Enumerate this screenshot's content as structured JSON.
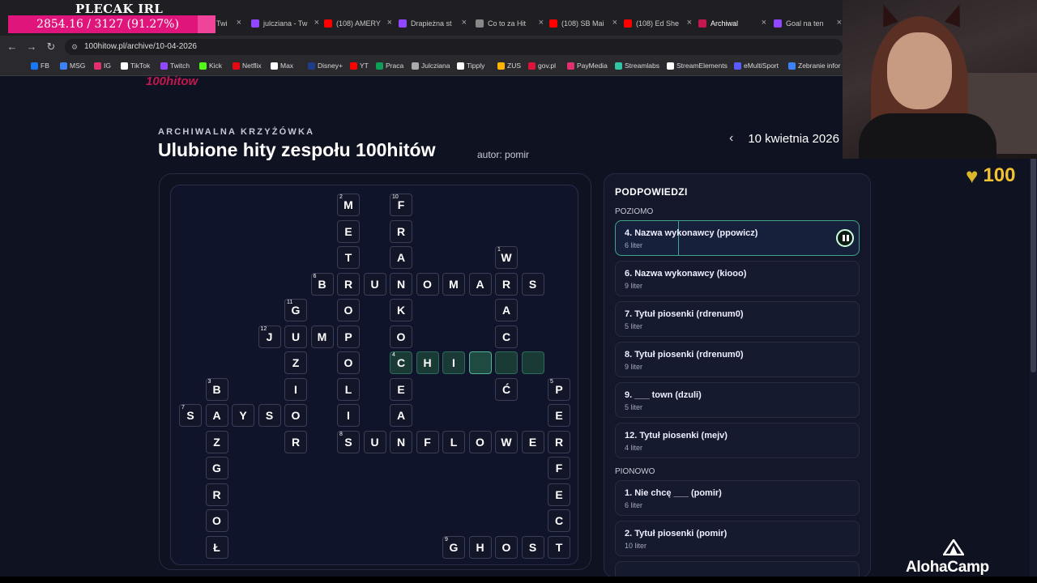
{
  "overlay": {
    "title": "PLECAK IRL",
    "goal_text": "2854.16 / 3127 (91.27%)",
    "goal_progress": 0.9127
  },
  "browser": {
    "tabs": [
      {
        "label": "Twi",
        "color": "#9146ff"
      },
      {
        "label": "julcziana - Tw",
        "color": "#9146ff"
      },
      {
        "label": "(108) AMERY",
        "color": "#ff0000"
      },
      {
        "label": "Drapieżna st",
        "color": "#9146ff"
      },
      {
        "label": "Co to za Hit",
        "color": "#888888"
      },
      {
        "label": "(108) SB Mai",
        "color": "#ff0000"
      },
      {
        "label": "(108) Ed She",
        "color": "#ff0000"
      },
      {
        "label": "Archiwal",
        "color": "#c2184f"
      },
      {
        "label": "Goal na ten",
        "color": "#9146ff"
      }
    ],
    "url": "100hitow.pl/archive/10-04-2026",
    "bookmarks": [
      {
        "label": "FB",
        "color": "#1877f2"
      },
      {
        "label": "MSG",
        "color": "#3b82f6"
      },
      {
        "label": "IG",
        "color": "#e1306c"
      },
      {
        "label": "TikTok",
        "color": "#ffffff"
      },
      {
        "label": "Twitch",
        "color": "#9146ff"
      },
      {
        "label": "Kick",
        "color": "#53fc18"
      },
      {
        "label": "Netflix",
        "color": "#e50914"
      },
      {
        "label": "Max",
        "color": "#ffffff"
      },
      {
        "label": "Disney+",
        "color": "#1f3c88"
      },
      {
        "label": "YT",
        "color": "#ff0000"
      },
      {
        "label": "Praca",
        "color": "#0f9d58"
      },
      {
        "label": "Julcziana",
        "color": "#aaaaaa"
      },
      {
        "label": "Tipply",
        "color": "#ffffff"
      },
      {
        "label": "ZUS",
        "color": "#ffb400"
      },
      {
        "label": "gov.pl",
        "color": "#dc143c"
      },
      {
        "label": "PayMedia",
        "color": "#e1306c"
      },
      {
        "label": "Streamlabs",
        "color": "#31c3a2"
      },
      {
        "label": "StreamElements",
        "color": "#ffffff"
      },
      {
        "label": "eMultiSport",
        "color": "#5a5aff"
      },
      {
        "label": "Zebranie infor",
        "color": "#3b82f6"
      }
    ]
  },
  "page": {
    "logo": "100hitow",
    "eyebrow": "ARCHIWALNA KRZYŻÓWKA",
    "title": "Ulubione hity zespołu 100hitów",
    "author": "autor: pomir",
    "date": "10 kwietnia 2026",
    "coins": "100"
  },
  "crossword": {
    "cells": [
      {
        "l": "M",
        "c": 6,
        "r": 0,
        "n": "2"
      },
      {
        "l": "E",
        "c": 6,
        "r": 1
      },
      {
        "l": "T",
        "c": 6,
        "r": 2
      },
      {
        "l": "R",
        "c": 6,
        "r": 3
      },
      {
        "l": "O",
        "c": 6,
        "r": 4
      },
      {
        "l": "P",
        "c": 6,
        "r": 5
      },
      {
        "l": "O",
        "c": 6,
        "r": 6
      },
      {
        "l": "L",
        "c": 6,
        "r": 7
      },
      {
        "l": "I",
        "c": 6,
        "r": 8
      },
      {
        "l": "S",
        "c": 6,
        "r": 9,
        "n": "8"
      },
      {
        "l": "F",
        "c": 8,
        "r": 0,
        "n": "10"
      },
      {
        "l": "R",
        "c": 8,
        "r": 1
      },
      {
        "l": "A",
        "c": 8,
        "r": 2
      },
      {
        "l": "N",
        "c": 8,
        "r": 3
      },
      {
        "l": "K",
        "c": 8,
        "r": 4
      },
      {
        "l": "O",
        "c": 8,
        "r": 5
      },
      {
        "l": "C",
        "c": 8,
        "r": 6,
        "n": "4",
        "s": "active"
      },
      {
        "l": "E",
        "c": 8,
        "r": 7
      },
      {
        "l": "A",
        "c": 8,
        "r": 8
      },
      {
        "l": "N",
        "c": 8,
        "r": 9
      },
      {
        "l": "W",
        "c": 12,
        "r": 2,
        "n": "1"
      },
      {
        "l": "R",
        "c": 12,
        "r": 3
      },
      {
        "l": "A",
        "c": 12,
        "r": 4
      },
      {
        "l": "C",
        "c": 12,
        "r": 5
      },
      {
        "l": "",
        "c": 12,
        "r": 6,
        "s": "active"
      },
      {
        "l": "Ć",
        "c": 12,
        "r": 7
      },
      {
        "l": "W",
        "c": 12,
        "r": 9
      },
      {
        "l": "B",
        "c": 5,
        "r": 3,
        "n": "6"
      },
      {
        "l": "U",
        "c": 7,
        "r": 3
      },
      {
        "l": "O",
        "c": 9,
        "r": 3
      },
      {
        "l": "M",
        "c": 10,
        "r": 3
      },
      {
        "l": "A",
        "c": 11,
        "r": 3
      },
      {
        "l": "S",
        "c": 13,
        "r": 3
      },
      {
        "l": "G",
        "c": 4,
        "r": 4,
        "n": "11"
      },
      {
        "l": "U",
        "c": 4,
        "r": 5
      },
      {
        "l": "Z",
        "c": 4,
        "r": 6
      },
      {
        "l": "I",
        "c": 4,
        "r": 7
      },
      {
        "l": "O",
        "c": 4,
        "r": 8
      },
      {
        "l": "R",
        "c": 4,
        "r": 9
      },
      {
        "l": "J",
        "c": 3,
        "r": 5,
        "n": "12"
      },
      {
        "l": "M",
        "c": 5,
        "r": 5
      },
      {
        "l": "H",
        "c": 9,
        "r": 6,
        "s": "active"
      },
      {
        "l": "I",
        "c": 10,
        "r": 6,
        "s": "active"
      },
      {
        "l": "",
        "c": 11,
        "r": 6,
        "s": "cursor"
      },
      {
        "l": "",
        "c": 13,
        "r": 6,
        "s": "active"
      },
      {
        "l": "B",
        "c": 1,
        "r": 7,
        "n": "3"
      },
      {
        "l": "A",
        "c": 1,
        "r": 8
      },
      {
        "l": "Z",
        "c": 1,
        "r": 9
      },
      {
        "l": "G",
        "c": 1,
        "r": 10
      },
      {
        "l": "R",
        "c": 1,
        "r": 11
      },
      {
        "l": "O",
        "c": 1,
        "r": 12
      },
      {
        "l": "Ł",
        "c": 1,
        "r": 13
      },
      {
        "l": "S",
        "c": 0,
        "r": 8,
        "n": "7"
      },
      {
        "l": "Y",
        "c": 2,
        "r": 8
      },
      {
        "l": "S",
        "c": 3,
        "r": 8
      },
      {
        "l": "P",
        "c": 14,
        "r": 7,
        "n": "5"
      },
      {
        "l": "E",
        "c": 14,
        "r": 8
      },
      {
        "l": "R",
        "c": 14,
        "r": 9
      },
      {
        "l": "F",
        "c": 14,
        "r": 10
      },
      {
        "l": "E",
        "c": 14,
        "r": 11
      },
      {
        "l": "C",
        "c": 14,
        "r": 12
      },
      {
        "l": "T",
        "c": 14,
        "r": 13
      },
      {
        "l": "U",
        "c": 7,
        "r": 9
      },
      {
        "l": "F",
        "c": 9,
        "r": 9
      },
      {
        "l": "L",
        "c": 10,
        "r": 9
      },
      {
        "l": "O",
        "c": 11,
        "r": 9
      },
      {
        "l": "E",
        "c": 13,
        "r": 9
      },
      {
        "l": "G",
        "c": 10,
        "r": 13,
        "n": "9"
      },
      {
        "l": "H",
        "c": 11,
        "r": 13
      },
      {
        "l": "O",
        "c": 12,
        "r": 13
      },
      {
        "l": "S",
        "c": 13,
        "r": 13
      }
    ]
  },
  "hints": {
    "title": "PODPOWIEDZI",
    "across_label": "POZIOMO",
    "down_label": "PIONOWO",
    "across": [
      {
        "title": "4. Nazwa wykonawcy (ppowicz)",
        "len": "6 liter",
        "active": true,
        "progress": 0.26
      },
      {
        "title": "6. Nazwa wykonawcy (kiooo)",
        "len": "9 liter"
      },
      {
        "title": "7. Tytuł piosenki (rdrenum0)",
        "len": "5 liter"
      },
      {
        "title": "8. Tytuł piosenki (rdrenum0)",
        "len": "9 liter"
      },
      {
        "title": "9. ___ town (dzuli)",
        "len": "5 liter"
      },
      {
        "title": "12. Tytuł piosenki (mejv)",
        "len": "4 liter"
      }
    ],
    "down": [
      {
        "title": "1. Nie chcę ___ (pomir)",
        "len": "6 liter"
      },
      {
        "title": "2. Tytuł piosenki (pomir)",
        "len": "10 liter"
      }
    ]
  },
  "watermark": "AlohaCamp"
}
